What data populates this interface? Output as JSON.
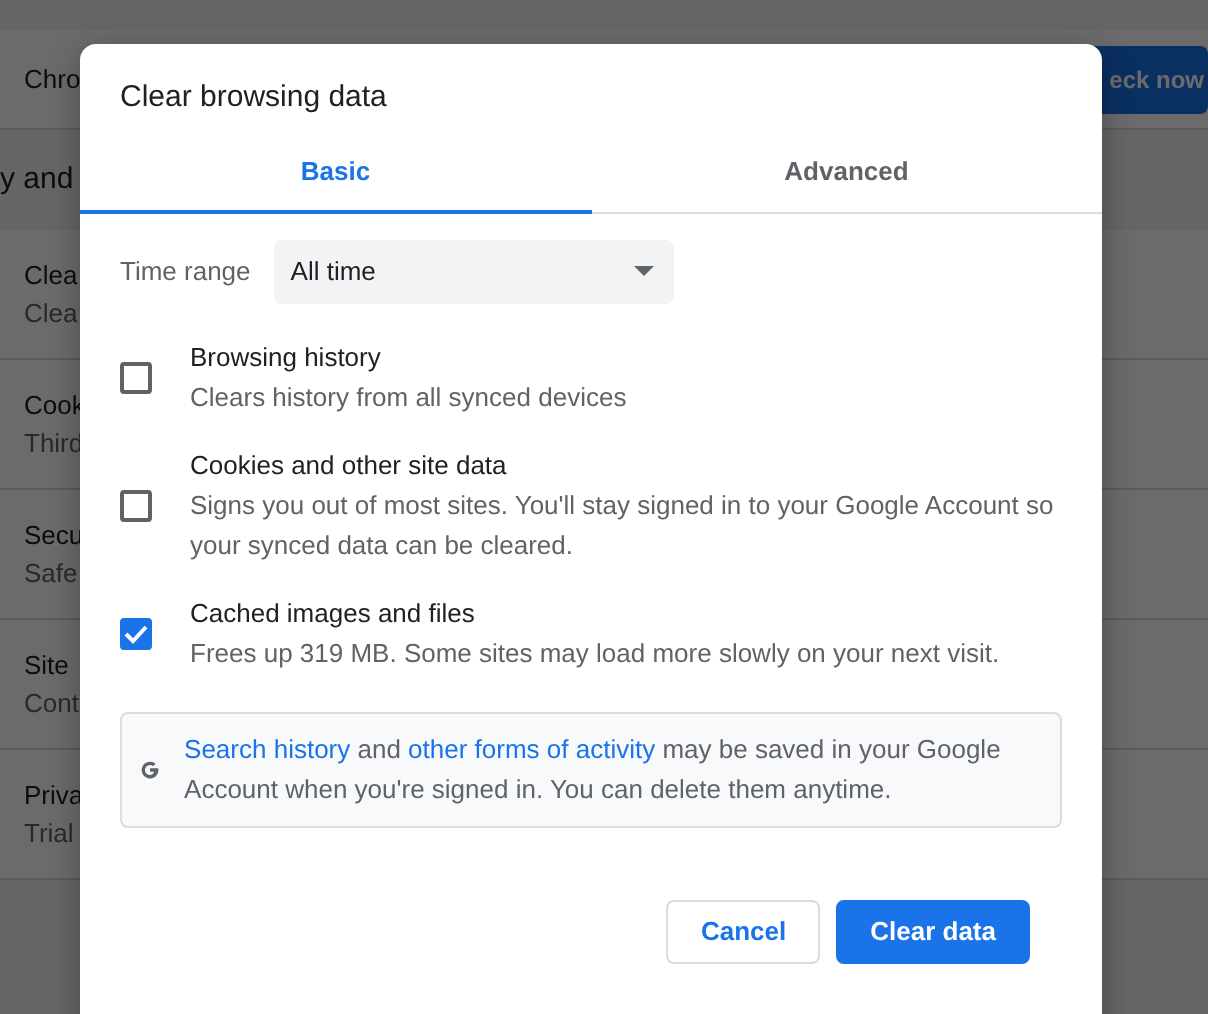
{
  "background_page": {
    "header_text": "Chro",
    "header_button": "eck now",
    "section_title": "y and",
    "rows": [
      {
        "title": "Clea",
        "subtitle": "Clea"
      },
      {
        "title": "Cook",
        "subtitle": "Third"
      },
      {
        "title": "Secu",
        "subtitle": "Safe"
      },
      {
        "title": "Site",
        "subtitle": "Cont"
      },
      {
        "title": "Priva",
        "subtitle": "Trial"
      }
    ]
  },
  "dialog": {
    "title": "Clear browsing data",
    "tabs": [
      {
        "label": "Basic",
        "selected": true
      },
      {
        "label": "Advanced",
        "selected": false
      }
    ],
    "time_range": {
      "label": "Time range",
      "value": "All time"
    },
    "options": [
      {
        "label": "Browsing history",
        "description": "Clears history from all synced devices",
        "checked": false
      },
      {
        "label": "Cookies and other site data",
        "description": "Signs you out of most sites. You'll stay signed in to your Google Account so your synced data can be cleared.",
        "checked": false
      },
      {
        "label": "Cached images and files",
        "description": "Frees up 319 MB. Some sites may load more slowly on your next visit.",
        "checked": true
      }
    ],
    "info": [
      {
        "kind": "link",
        "text": "Search history"
      },
      {
        "kind": "text",
        "text": " and "
      },
      {
        "kind": "link",
        "text": "other forms of activity"
      },
      {
        "kind": "text",
        "text": " may be saved in your Google Account when you're signed in. You can delete them anytime."
      }
    ],
    "buttons": [
      {
        "label": "Cancel",
        "kind": "secondary"
      },
      {
        "label": "Clear data",
        "kind": "primary"
      }
    ]
  }
}
